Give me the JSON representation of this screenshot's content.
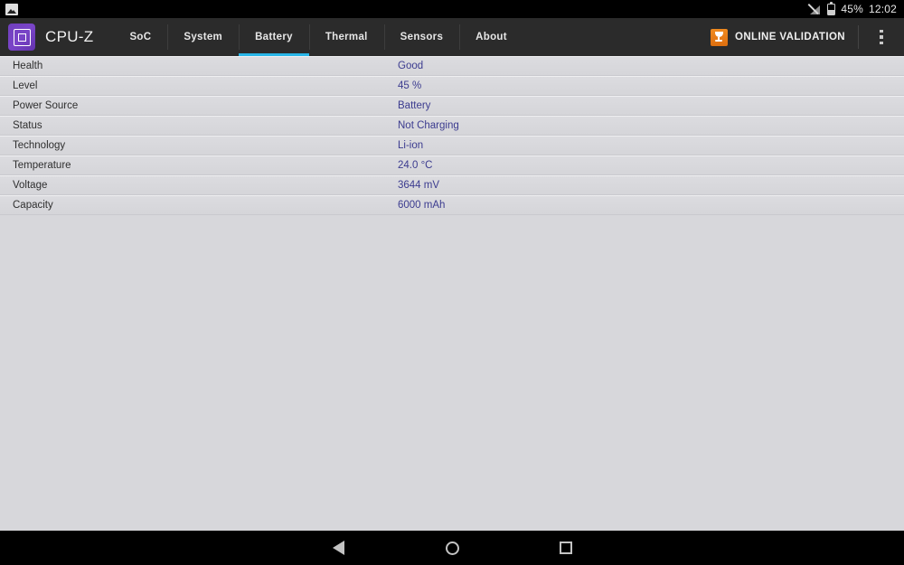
{
  "status_bar": {
    "notification_icon": "image-notification-icon",
    "signal_icon": "signal-off-icon",
    "battery_icon": "battery-icon",
    "battery_percent": "45%",
    "clock": "12:02"
  },
  "app_bar": {
    "logo_icon": "cpu-chip-icon",
    "title": "CPU-Z",
    "tabs": [
      {
        "label": "SoC",
        "active": false
      },
      {
        "label": "System",
        "active": false
      },
      {
        "label": "Battery",
        "active": true
      },
      {
        "label": "Thermal",
        "active": false
      },
      {
        "label": "Sensors",
        "active": false
      },
      {
        "label": "About",
        "active": false
      }
    ],
    "active_tab_color": "#29b6e8",
    "validation": {
      "icon": "trophy-icon",
      "label": "ONLINE VALIDATION",
      "icon_color": "#e8791a"
    },
    "overflow_menu_icon": "more-vertical-icon"
  },
  "battery": {
    "rows": [
      {
        "label": "Health",
        "value": "Good"
      },
      {
        "label": "Level",
        "value": "45 %"
      },
      {
        "label": "Power Source",
        "value": "Battery"
      },
      {
        "label": "Status",
        "value": "Not Charging"
      },
      {
        "label": "Technology",
        "value": "Li-ion"
      },
      {
        "label": "Temperature",
        "value": "24.0 °C"
      },
      {
        "label": "Voltage",
        "value": "3644 mV"
      },
      {
        "label": "Capacity",
        "value": "6000 mAh"
      }
    ],
    "label_color": "#2f2f2f",
    "value_color": "#3b3b8f"
  },
  "nav_bar": {
    "back_icon": "back-triangle-icon",
    "home_icon": "home-circle-icon",
    "recents_icon": "recents-square-icon"
  }
}
